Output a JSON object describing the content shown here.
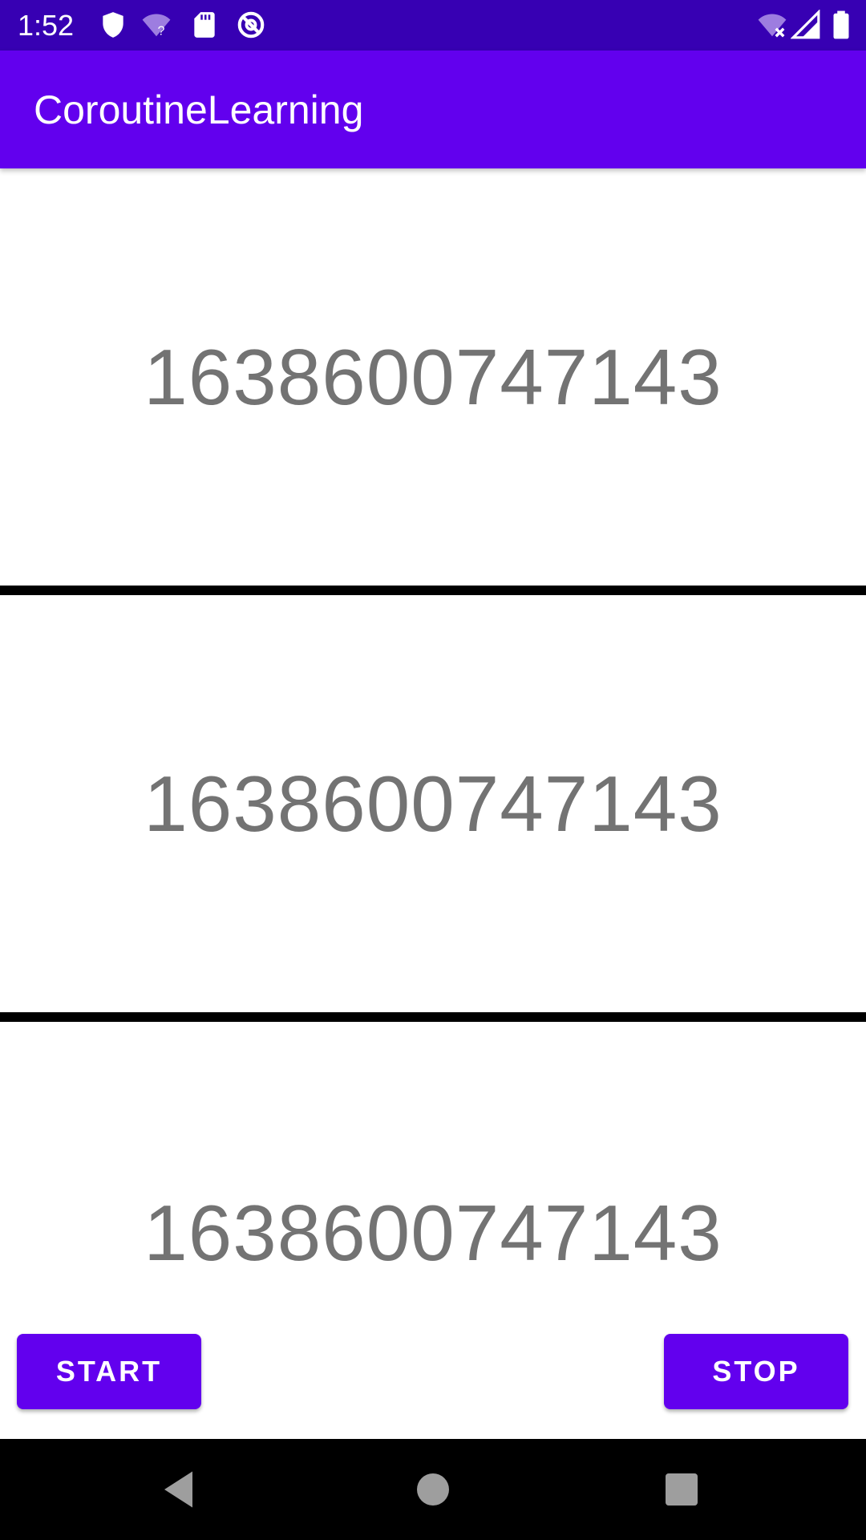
{
  "status_bar": {
    "time": "1:52",
    "icons": [
      "shield-icon",
      "wifi-question-icon",
      "sd-card-icon",
      "no-data-icon",
      "wifi-x-icon",
      "signal-icon",
      "battery-icon"
    ]
  },
  "app_bar": {
    "title": "CoroutineLearning"
  },
  "counters": [
    {
      "value": "1638600747143"
    },
    {
      "value": "1638600747143"
    },
    {
      "value": "1638600747143"
    }
  ],
  "buttons": {
    "start_label": "START",
    "stop_label": "STOP"
  },
  "nav_bar": {
    "icons": [
      "back-icon",
      "home-icon",
      "recents-icon"
    ]
  },
  "colors": {
    "status_bar": "#3700B3",
    "primary": "#6200EE",
    "counter_text": "#737373",
    "divider": "#000000"
  }
}
